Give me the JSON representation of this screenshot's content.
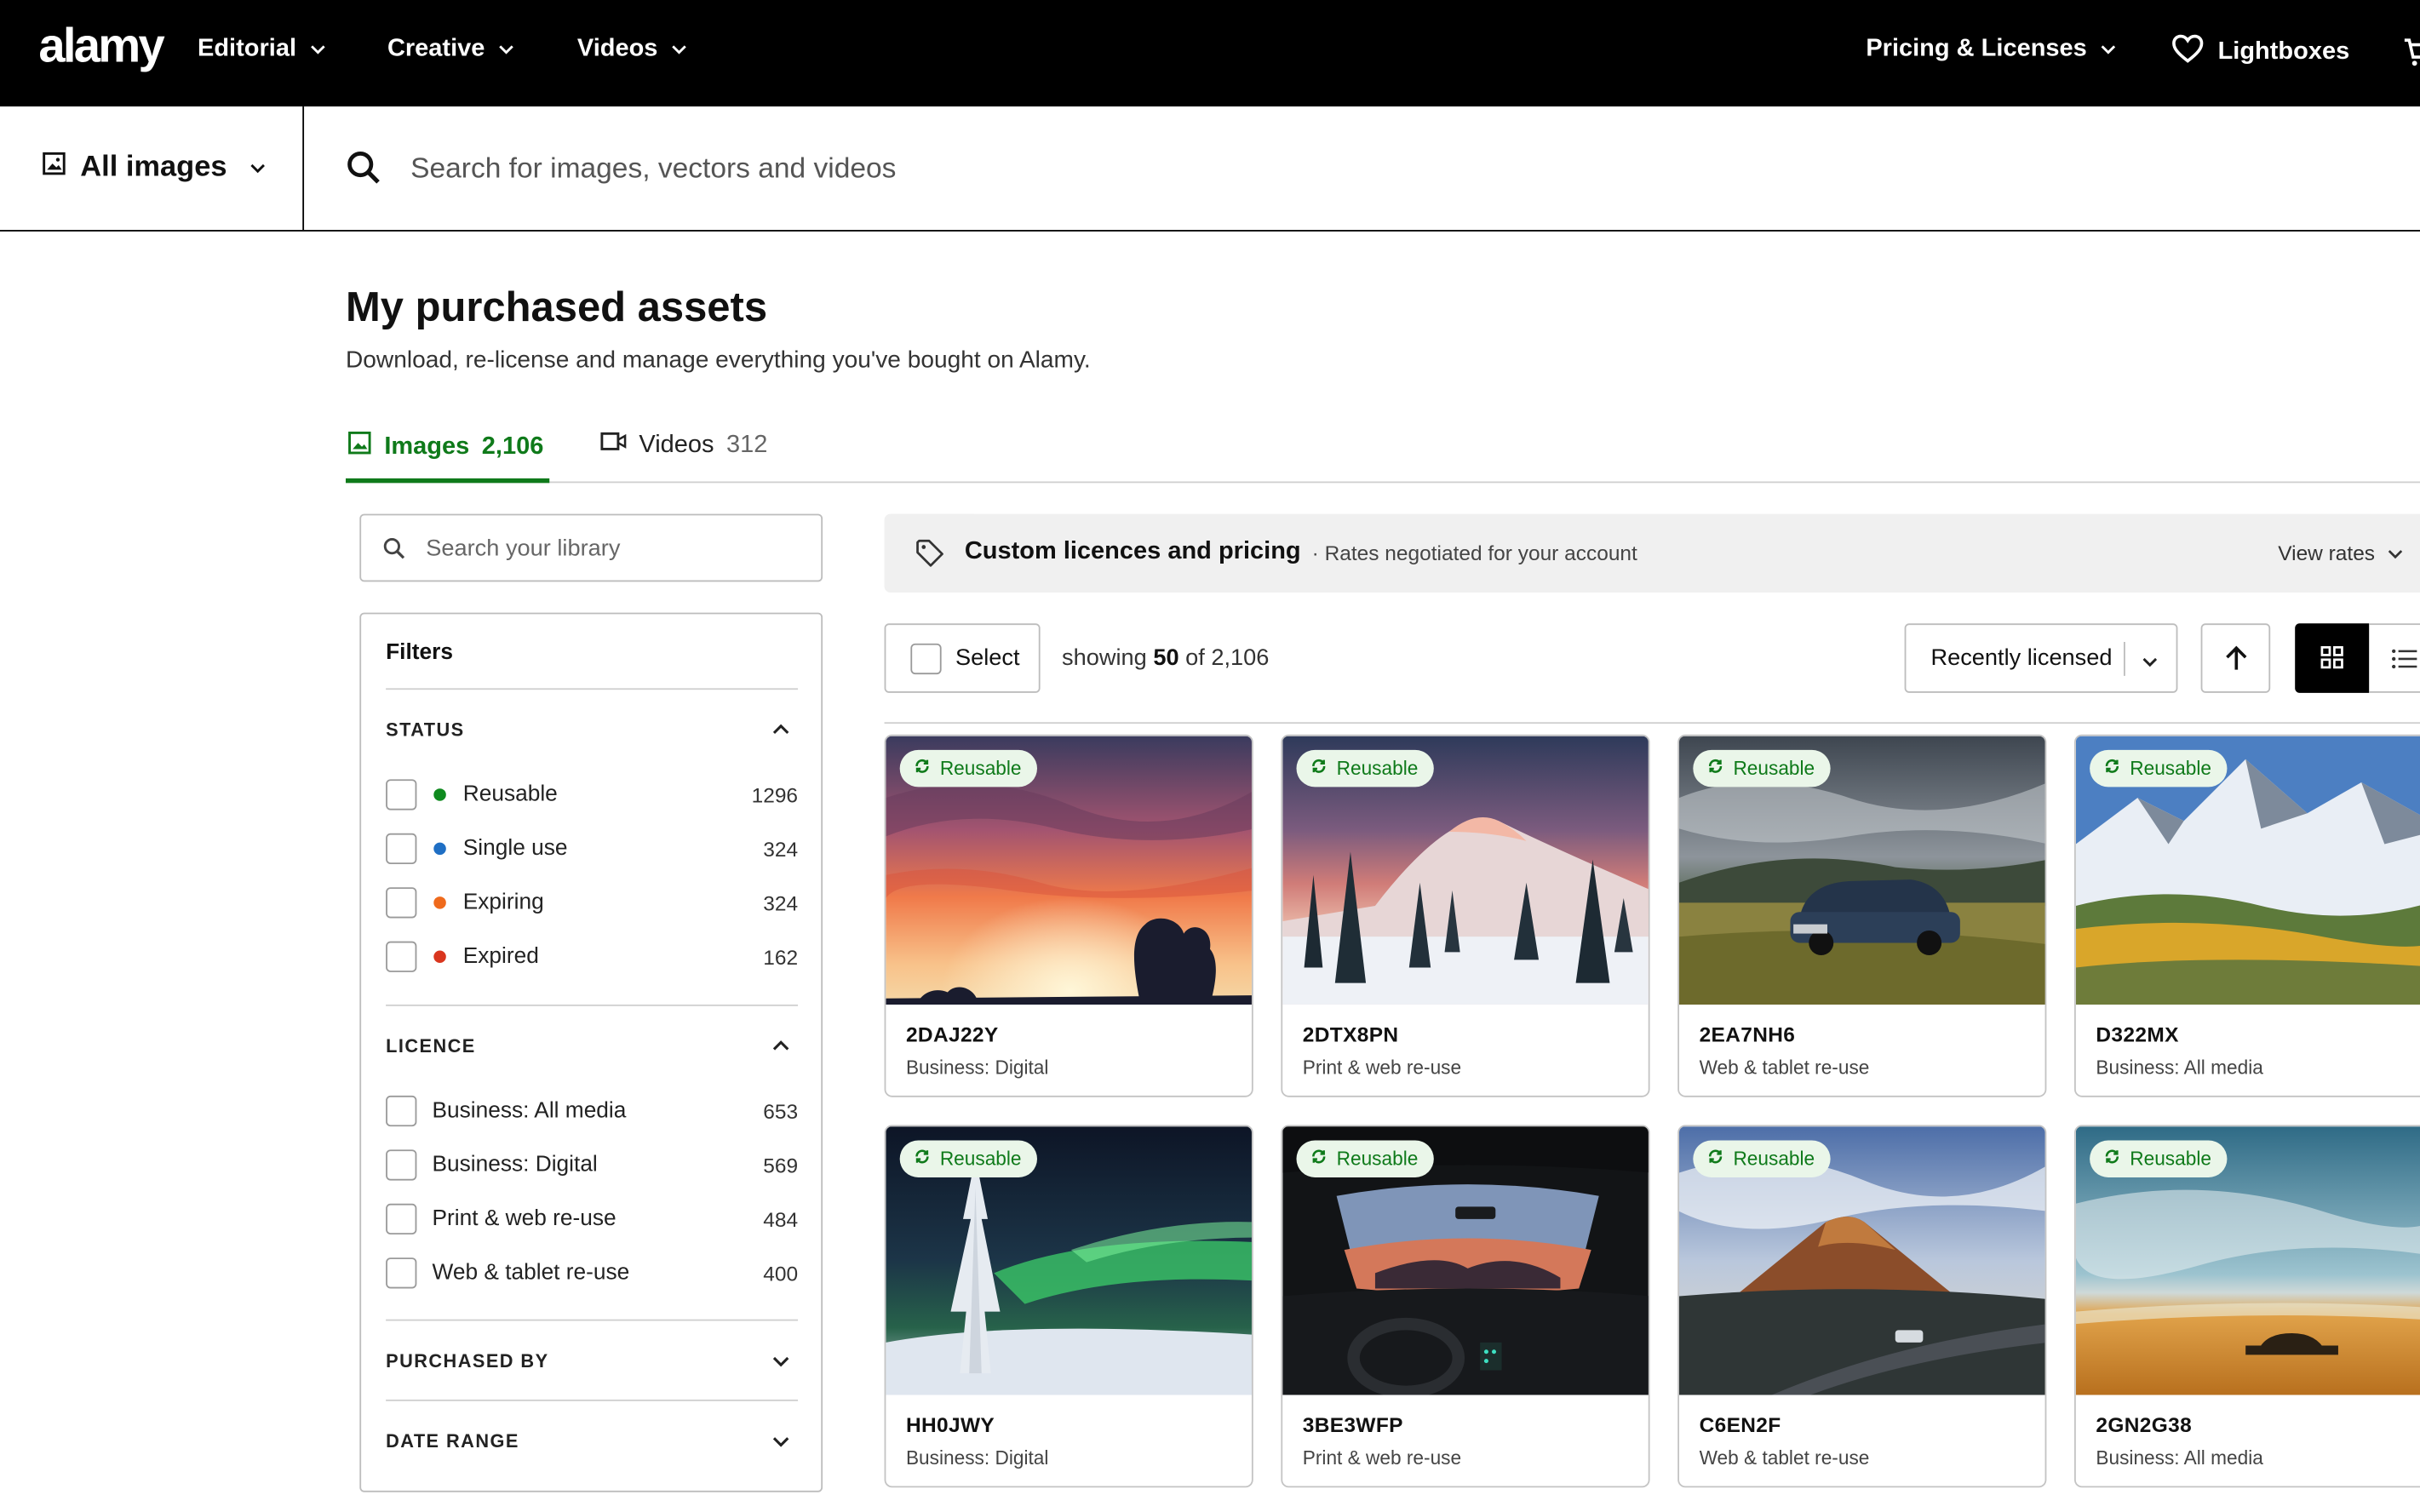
{
  "nav": {
    "logo": "alamy",
    "items": [
      "Editorial",
      "Creative",
      "Videos"
    ],
    "pricing": "Pricing & Licenses",
    "lightboxes": "Lightboxes"
  },
  "search": {
    "scope": "All images",
    "placeholder": "Search for images, vectors and videos"
  },
  "page": {
    "title": "My purchased assets",
    "subtitle": "Download, re-license and manage everything you've bought on Alamy."
  },
  "tabs": [
    {
      "label": "Images",
      "count": "2,106",
      "active": true
    },
    {
      "label": "Videos",
      "count": "312",
      "active": false
    }
  ],
  "library_search": {
    "placeholder": "Search your library"
  },
  "filters": {
    "title": "Filters",
    "status": {
      "title": "STATUS",
      "items": [
        {
          "label": "Reusable",
          "count": "1296",
          "color": "#0f8a1f"
        },
        {
          "label": "Single use",
          "count": "324",
          "color": "#1f6fc4"
        },
        {
          "label": "Expiring",
          "count": "324",
          "color": "#ef6a1c"
        },
        {
          "label": "Expired",
          "count": "162",
          "color": "#d9361e"
        }
      ]
    },
    "licence": {
      "title": "LICENCE",
      "items": [
        {
          "label": "Business: All media",
          "count": "653"
        },
        {
          "label": "Business: Digital",
          "count": "569"
        },
        {
          "label": "Print & web re-use",
          "count": "484"
        },
        {
          "label": "Web & tablet re-use",
          "count": "400"
        }
      ]
    },
    "purchased_by": {
      "title": "PURCHASED BY"
    },
    "date_range": {
      "title": "DATE RANGE"
    }
  },
  "banner": {
    "title": "Custom licences and pricing",
    "subtitle": "· Rates negotiated for your account",
    "action": "View rates"
  },
  "toolbar": {
    "select_label": "Select",
    "showing_prefix": "showing",
    "showing_count": "50",
    "showing_suffix": "of 2,106",
    "sort_label": "Recently licensed"
  },
  "assets": [
    {
      "id": "2DAJ22Y",
      "licence": "Business: Digital",
      "badge": "Reusable"
    },
    {
      "id": "2DTX8PN",
      "licence": "Print & web re-use",
      "badge": "Reusable"
    },
    {
      "id": "2EA7NH6",
      "licence": "Web & tablet re-use",
      "badge": "Reusable"
    },
    {
      "id": "D322MX",
      "licence": "Business: All media",
      "badge": "Reusable"
    },
    {
      "id": "HH0JWY",
      "licence": "Business: Digital",
      "badge": "Reusable"
    },
    {
      "id": "3BE3WFP",
      "licence": "Print & web re-use",
      "badge": "Reusable"
    },
    {
      "id": "C6EN2F",
      "licence": "Web & tablet re-use",
      "badge": "Reusable"
    },
    {
      "id": "2GN2G38",
      "licence": "Business: All media",
      "badge": "Reusable"
    }
  ],
  "colors": {
    "accent_green": "#0f7a1a",
    "badge_bg": "#eaf6e9",
    "nav_bg": "#000000",
    "banner_bg": "#f0f0f0"
  }
}
